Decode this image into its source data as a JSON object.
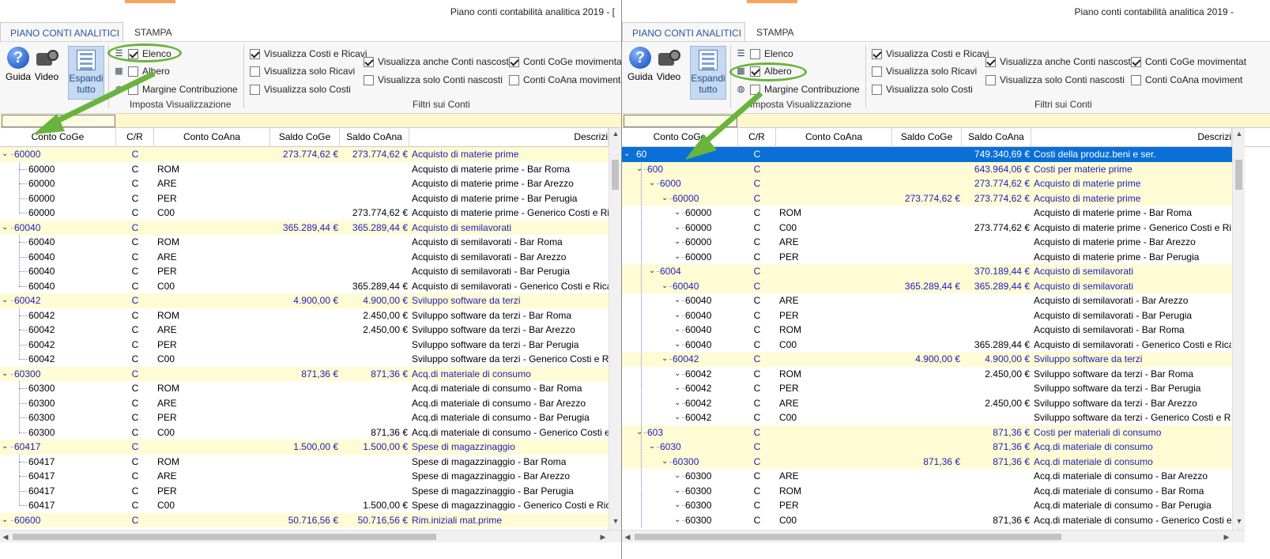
{
  "colors": {
    "accent": "#2b579a",
    "group_text": "#2020c0",
    "group_bg": "#fffbd4",
    "selected": "#0a6fd6",
    "highlight": "#6ab33c"
  },
  "left": {
    "title": "Piano conti contabilità analitica 2019 - [",
    "tabs": [
      "PIANO CONTI ANALITICI",
      "STAMPA"
    ],
    "ribbon": {
      "guida": "Guida",
      "video": "Video",
      "espandi": [
        "Espandi",
        "tutto"
      ],
      "elenco": "Elenco",
      "albero": "Albero",
      "margine": "Margine Contribuzione",
      "imposta": "Imposta Visualizzazione",
      "vis_costi_ricavi": "Visualizza Costi e Ricavi",
      "vis_solo_ricavi": "Visualizza solo Ricavi",
      "vis_solo_costi": "Visualizza solo Costi",
      "vis_anche_nascosti": "Visualizza anche Conti nascosti",
      "vis_solo_nascosti": "Visualizza solo Conti nascosti",
      "coge_mov": "Conti CoGe movimentat",
      "coana_mov": "Conti CoAna moviment",
      "filtri": "Filtri sui Conti"
    },
    "columns": [
      "Conto CoGe",
      "C/R",
      "Conto CoAna",
      "Saldo CoGe",
      "Saldo CoAna",
      "Descrizi"
    ],
    "rows": [
      {
        "type": "grp",
        "coge": "60000",
        "cr": "C",
        "coana": "",
        "sc": "273.774,62 €",
        "sa": "273.774,62 €",
        "desc": "Acquisto di materie prime"
      },
      {
        "type": "ch",
        "coge": "60000",
        "cr": "C",
        "coana": "ROM",
        "sc": "",
        "sa": "",
        "desc": "Acquisto di materie prime - Bar Roma"
      },
      {
        "type": "ch",
        "coge": "60000",
        "cr": "C",
        "coana": "ARE",
        "sc": "",
        "sa": "",
        "desc": "Acquisto di materie prime - Bar Arezzo"
      },
      {
        "type": "ch",
        "coge": "60000",
        "cr": "C",
        "coana": "PER",
        "sc": "",
        "sa": "",
        "desc": "Acquisto di materie prime - Bar Perugia"
      },
      {
        "type": "ch",
        "coge": "60000",
        "cr": "C",
        "coana": "C00",
        "sc": "",
        "sa": "273.774,62 €",
        "desc": "Acquisto di materie prime - Generico Costi e Rica"
      },
      {
        "type": "grp",
        "coge": "60040",
        "cr": "C",
        "coana": "",
        "sc": "365.289,44 €",
        "sa": "365.289,44 €",
        "desc": "Acquisto di semilavorati"
      },
      {
        "type": "ch",
        "coge": "60040",
        "cr": "C",
        "coana": "ROM",
        "sc": "",
        "sa": "",
        "desc": "Acquisto di semilavorati - Bar Roma"
      },
      {
        "type": "ch",
        "coge": "60040",
        "cr": "C",
        "coana": "ARE",
        "sc": "",
        "sa": "",
        "desc": "Acquisto di semilavorati - Bar Arezzo"
      },
      {
        "type": "ch",
        "coge": "60040",
        "cr": "C",
        "coana": "PER",
        "sc": "",
        "sa": "",
        "desc": "Acquisto di semilavorati - Bar Perugia"
      },
      {
        "type": "ch",
        "coge": "60040",
        "cr": "C",
        "coana": "C00",
        "sc": "",
        "sa": "365.289,44 €",
        "desc": "Acquisto di semilavorati - Generico Costi e Ricavi"
      },
      {
        "type": "grp",
        "coge": "60042",
        "cr": "C",
        "coana": "",
        "sc": "4.900,00 €",
        "sa": "4.900,00 €",
        "desc": "Sviluppo software da terzi"
      },
      {
        "type": "ch",
        "coge": "60042",
        "cr": "C",
        "coana": "ROM",
        "sc": "",
        "sa": "2.450,00 €",
        "desc": "Sviluppo software da terzi - Bar Roma"
      },
      {
        "type": "ch",
        "coge": "60042",
        "cr": "C",
        "coana": "ARE",
        "sc": "",
        "sa": "2.450,00 €",
        "desc": "Sviluppo software da terzi - Bar Arezzo"
      },
      {
        "type": "ch",
        "coge": "60042",
        "cr": "C",
        "coana": "PER",
        "sc": "",
        "sa": "",
        "desc": "Sviluppo software da terzi - Bar Perugia"
      },
      {
        "type": "ch",
        "coge": "60042",
        "cr": "C",
        "coana": "C00",
        "sc": "",
        "sa": "",
        "desc": "Sviluppo software da terzi - Generico Costi e Rica"
      },
      {
        "type": "grp",
        "coge": "60300",
        "cr": "C",
        "coana": "",
        "sc": "871,36 €",
        "sa": "871,36 €",
        "desc": "Acq.di materiale di consumo"
      },
      {
        "type": "ch",
        "coge": "60300",
        "cr": "C",
        "coana": "ROM",
        "sc": "",
        "sa": "",
        "desc": "Acq.di materiale di consumo - Bar Roma"
      },
      {
        "type": "ch",
        "coge": "60300",
        "cr": "C",
        "coana": "ARE",
        "sc": "",
        "sa": "",
        "desc": "Acq.di materiale di consumo - Bar Arezzo"
      },
      {
        "type": "ch",
        "coge": "60300",
        "cr": "C",
        "coana": "PER",
        "sc": "",
        "sa": "",
        "desc": "Acq.di materiale di consumo - Bar Perugia"
      },
      {
        "type": "ch",
        "coge": "60300",
        "cr": "C",
        "coana": "C00",
        "sc": "",
        "sa": "871,36 €",
        "desc": "Acq.di materiale di consumo - Generico Costi e R"
      },
      {
        "type": "grp",
        "coge": "60417",
        "cr": "C",
        "coana": "",
        "sc": "1.500,00 €",
        "sa": "1.500,00 €",
        "desc": "Spese di magazzinaggio"
      },
      {
        "type": "ch",
        "coge": "60417",
        "cr": "C",
        "coana": "ROM",
        "sc": "",
        "sa": "",
        "desc": "Spese di magazzinaggio - Bar Roma"
      },
      {
        "type": "ch",
        "coge": "60417",
        "cr": "C",
        "coana": "ARE",
        "sc": "",
        "sa": "",
        "desc": "Spese di magazzinaggio - Bar Arezzo"
      },
      {
        "type": "ch",
        "coge": "60417",
        "cr": "C",
        "coana": "PER",
        "sc": "",
        "sa": "",
        "desc": "Spese di magazzinaggio - Bar Perugia"
      },
      {
        "type": "ch",
        "coge": "60417",
        "cr": "C",
        "coana": "C00",
        "sc": "",
        "sa": "1.500,00 €",
        "desc": "Spese di magazzinaggio - Generico Costi e Ricavi"
      },
      {
        "type": "grp",
        "coge": "60600",
        "cr": "C",
        "coana": "",
        "sc": "50.716,56 €",
        "sa": "50.716,56 €",
        "desc": "Rim.iniziali mat.prime"
      }
    ]
  },
  "right": {
    "title": "Piano conti contabilità analitica 2019 -",
    "tabs": [
      "PIANO CONTI ANALITICI",
      "STAMPA"
    ],
    "ribbon": {
      "guida": "Guida",
      "video": "Video",
      "espandi": [
        "Espandi",
        "tutto"
      ],
      "elenco": "Elenco",
      "albero": "Albero",
      "margine": "Margine Contribuzione",
      "imposta": "Imposta Visualizzazione",
      "vis_costi_ricavi": "Visualizza Costi e Ricavi",
      "vis_solo_ricavi": "Visualizza solo Ricavi",
      "vis_solo_costi": "Visualizza solo Costi",
      "vis_anche_nascosti": "Visualizza anche Conti nascosti",
      "vis_solo_nascosti": "Visualizza solo Conti nascosti",
      "coge_mov": "Conti CoGe movimentat",
      "coana_mov": "Conti CoAna moviment",
      "filtri": "Filtri sui Conti"
    },
    "columns": [
      "Conto CoGe",
      "C/R",
      "Conto CoAna",
      "Saldo CoGe",
      "Saldo CoAna",
      "Descrizi"
    ],
    "rows": [
      {
        "type": "sel",
        "lvl": 0,
        "coge": "60",
        "cr": "C",
        "coana": "",
        "sc": "",
        "sa": "749.340,69 €",
        "desc": "Costi della produz.beni e ser."
      },
      {
        "type": "grp",
        "lvl": 1,
        "coge": "600",
        "cr": "C",
        "coana": "",
        "sc": "",
        "sa": "643.964,06 €",
        "desc": "Costi per materie prime"
      },
      {
        "type": "grp",
        "lvl": 2,
        "coge": "6000",
        "cr": "C",
        "coana": "",
        "sc": "",
        "sa": "273.774,62 €",
        "desc": "Acquisto di materie prime"
      },
      {
        "type": "grp",
        "lvl": 3,
        "coge": "60000",
        "cr": "C",
        "coana": "",
        "sc": "273.774,62 €",
        "sa": "273.774,62 €",
        "desc": "Acquisto di materie prime"
      },
      {
        "type": "ch",
        "lvl": 4,
        "coge": "60000",
        "cr": "C",
        "coana": "ROM",
        "sc": "",
        "sa": "",
        "desc": "Acquisto di materie prime - Bar Roma"
      },
      {
        "type": "ch",
        "lvl": 4,
        "coge": "60000",
        "cr": "C",
        "coana": "C00",
        "sc": "",
        "sa": "273.774,62 €",
        "desc": "Acquisto di materie prime - Generico Costi e Rica"
      },
      {
        "type": "ch",
        "lvl": 4,
        "coge": "60000",
        "cr": "C",
        "coana": "ARE",
        "sc": "",
        "sa": "",
        "desc": "Acquisto di materie prime - Bar Arezzo"
      },
      {
        "type": "ch",
        "lvl": 4,
        "coge": "60000",
        "cr": "C",
        "coana": "PER",
        "sc": "",
        "sa": "",
        "desc": "Acquisto di materie prime - Bar Perugia"
      },
      {
        "type": "grp",
        "lvl": 2,
        "coge": "6004",
        "cr": "C",
        "coana": "",
        "sc": "",
        "sa": "370.189,44 €",
        "desc": "Acquisto di semilavorati"
      },
      {
        "type": "grp",
        "lvl": 3,
        "coge": "60040",
        "cr": "C",
        "coana": "",
        "sc": "365.289,44 €",
        "sa": "365.289,44 €",
        "desc": "Acquisto di semilavorati"
      },
      {
        "type": "ch",
        "lvl": 4,
        "coge": "60040",
        "cr": "C",
        "coana": "ARE",
        "sc": "",
        "sa": "",
        "desc": "Acquisto di semilavorati - Bar Arezzo"
      },
      {
        "type": "ch",
        "lvl": 4,
        "coge": "60040",
        "cr": "C",
        "coana": "PER",
        "sc": "",
        "sa": "",
        "desc": "Acquisto di semilavorati - Bar Perugia"
      },
      {
        "type": "ch",
        "lvl": 4,
        "coge": "60040",
        "cr": "C",
        "coana": "ROM",
        "sc": "",
        "sa": "",
        "desc": "Acquisto di semilavorati - Bar Roma"
      },
      {
        "type": "ch",
        "lvl": 4,
        "coge": "60040",
        "cr": "C",
        "coana": "C00",
        "sc": "",
        "sa": "365.289,44 €",
        "desc": "Acquisto di semilavorati - Generico Costi e Ricavi"
      },
      {
        "type": "grp",
        "lvl": 3,
        "coge": "60042",
        "cr": "C",
        "coana": "",
        "sc": "4.900,00 €",
        "sa": "4.900,00 €",
        "desc": "Sviluppo software da terzi"
      },
      {
        "type": "ch",
        "lvl": 4,
        "coge": "60042",
        "cr": "C",
        "coana": "ROM",
        "sc": "",
        "sa": "2.450,00 €",
        "desc": "Sviluppo software da terzi - Bar Roma"
      },
      {
        "type": "ch",
        "lvl": 4,
        "coge": "60042",
        "cr": "C",
        "coana": "PER",
        "sc": "",
        "sa": "",
        "desc": "Sviluppo software da terzi - Bar Perugia"
      },
      {
        "type": "ch",
        "lvl": 4,
        "coge": "60042",
        "cr": "C",
        "coana": "ARE",
        "sc": "",
        "sa": "2.450,00 €",
        "desc": "Sviluppo software da terzi - Bar Arezzo"
      },
      {
        "type": "ch",
        "lvl": 4,
        "coge": "60042",
        "cr": "C",
        "coana": "C00",
        "sc": "",
        "sa": "",
        "desc": "Sviluppo software da terzi - Generico Costi e Rica"
      },
      {
        "type": "grp",
        "lvl": 1,
        "coge": "603",
        "cr": "C",
        "coana": "",
        "sc": "",
        "sa": "871,36 €",
        "desc": "Costi per materiali di consumo"
      },
      {
        "type": "grp",
        "lvl": 2,
        "coge": "6030",
        "cr": "C",
        "coana": "",
        "sc": "",
        "sa": "871,36 €",
        "desc": "Acq.di materiale di consumo"
      },
      {
        "type": "grp",
        "lvl": 3,
        "coge": "60300",
        "cr": "C",
        "coana": "",
        "sc": "871,36 €",
        "sa": "871,36 €",
        "desc": "Acq.di materiale di consumo"
      },
      {
        "type": "ch",
        "lvl": 4,
        "coge": "60300",
        "cr": "C",
        "coana": "ARE",
        "sc": "",
        "sa": "",
        "desc": "Acq.di materiale di consumo - Bar Arezzo"
      },
      {
        "type": "ch",
        "lvl": 4,
        "coge": "60300",
        "cr": "C",
        "coana": "ROM",
        "sc": "",
        "sa": "",
        "desc": "Acq.di materiale di consumo - Bar Roma"
      },
      {
        "type": "ch",
        "lvl": 4,
        "coge": "60300",
        "cr": "C",
        "coana": "PER",
        "sc": "",
        "sa": "",
        "desc": "Acq.di materiale di consumo - Bar Perugia"
      },
      {
        "type": "ch",
        "lvl": 4,
        "coge": "60300",
        "cr": "C",
        "coana": "C00",
        "sc": "",
        "sa": "871,36 €",
        "desc": "Acq.di materiale di consumo - Generico Costi e R"
      }
    ]
  }
}
